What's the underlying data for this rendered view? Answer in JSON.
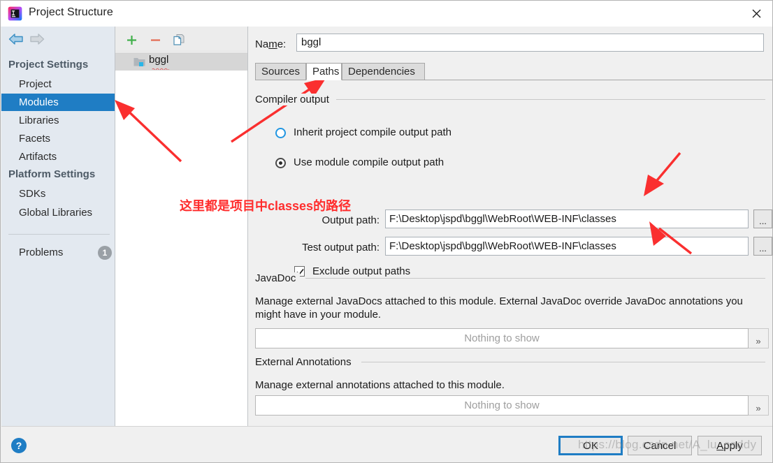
{
  "window": {
    "title": "Project Structure",
    "logo_icon": "intellij-idea-logo",
    "close_icon": "close-icon"
  },
  "nav": {
    "back_icon": "arrow-left-icon",
    "forward_icon": "arrow-right-icon"
  },
  "sidebar": {
    "groups": [
      {
        "label": "Project Settings"
      },
      {
        "label": "Platform Settings"
      }
    ],
    "items": [
      {
        "label": "Project",
        "selected": false
      },
      {
        "label": "Modules",
        "selected": true
      },
      {
        "label": "Libraries",
        "selected": false
      },
      {
        "label": "Facets",
        "selected": false
      },
      {
        "label": "Artifacts",
        "selected": false
      },
      {
        "label": "SDKs",
        "selected": false
      },
      {
        "label": "Global Libraries",
        "selected": false
      }
    ],
    "problems": {
      "label": "Problems",
      "count": "1"
    },
    "selected_color": "#1f7dc4",
    "background_color": "#e3e9f0"
  },
  "module_list": {
    "toolbar": {
      "add_icon": "plus-icon",
      "remove_icon": "minus-icon",
      "copy_icon": "copy-icon"
    },
    "items": [
      {
        "label": "bggl",
        "icon": "module-folder-icon",
        "selected": true,
        "spellcheck_error": true
      }
    ]
  },
  "main": {
    "name_field": {
      "label_prefix": "Na",
      "label_mnemonic": "m",
      "label_suffix": "e:",
      "value": "bggl"
    },
    "tabs": [
      {
        "label": "Sources",
        "active": false
      },
      {
        "label": "Paths",
        "active": true
      },
      {
        "label": "Dependencies",
        "active": false
      }
    ],
    "compiler_output": {
      "group_title": "Compiler output",
      "options": [
        {
          "label": "Inherit project compile output path",
          "selected": false
        },
        {
          "label": "Use module compile output path",
          "selected": true
        }
      ],
      "output_path": {
        "label": "Output path:",
        "value": "F:\\Desktop\\jspd\\bggl\\WebRoot\\WEB-INF\\classes",
        "browse_label": "..."
      },
      "test_output_path": {
        "label": "Test output path:",
        "value": "F:\\Desktop\\jspd\\bggl\\WebRoot\\WEB-INF\\classes",
        "browse_label": "..."
      },
      "exclude_checkbox": {
        "label": "Exclude output paths",
        "checked": true
      }
    },
    "javadoc": {
      "group_title": "JavaDoc",
      "description": "Manage external JavaDocs attached to this module. External JavaDoc override JavaDoc annotations you might have in your module.",
      "empty_text": "Nothing to show",
      "expand_label": "»"
    },
    "external_annotations": {
      "group_title": "External Annotations",
      "description": "Manage external annotations attached to this module.",
      "empty_text": "Nothing to show",
      "expand_label": "»"
    }
  },
  "footer": {
    "help_label": "?",
    "buttons": [
      {
        "label": "OK",
        "default": true,
        "mnemonic": ""
      },
      {
        "label": "Cancel",
        "default": false,
        "mnemonic": ""
      },
      {
        "label": "Apply",
        "default": false,
        "mnemonic": "A"
      }
    ]
  },
  "annotations": {
    "note_text": "这里都是项目中classes的路径",
    "arrow_color": "#fa2f2f",
    "arrow_count": 4
  },
  "watermark": {
    "text": "https://blog.csdn.net/A_lu_caddy"
  }
}
